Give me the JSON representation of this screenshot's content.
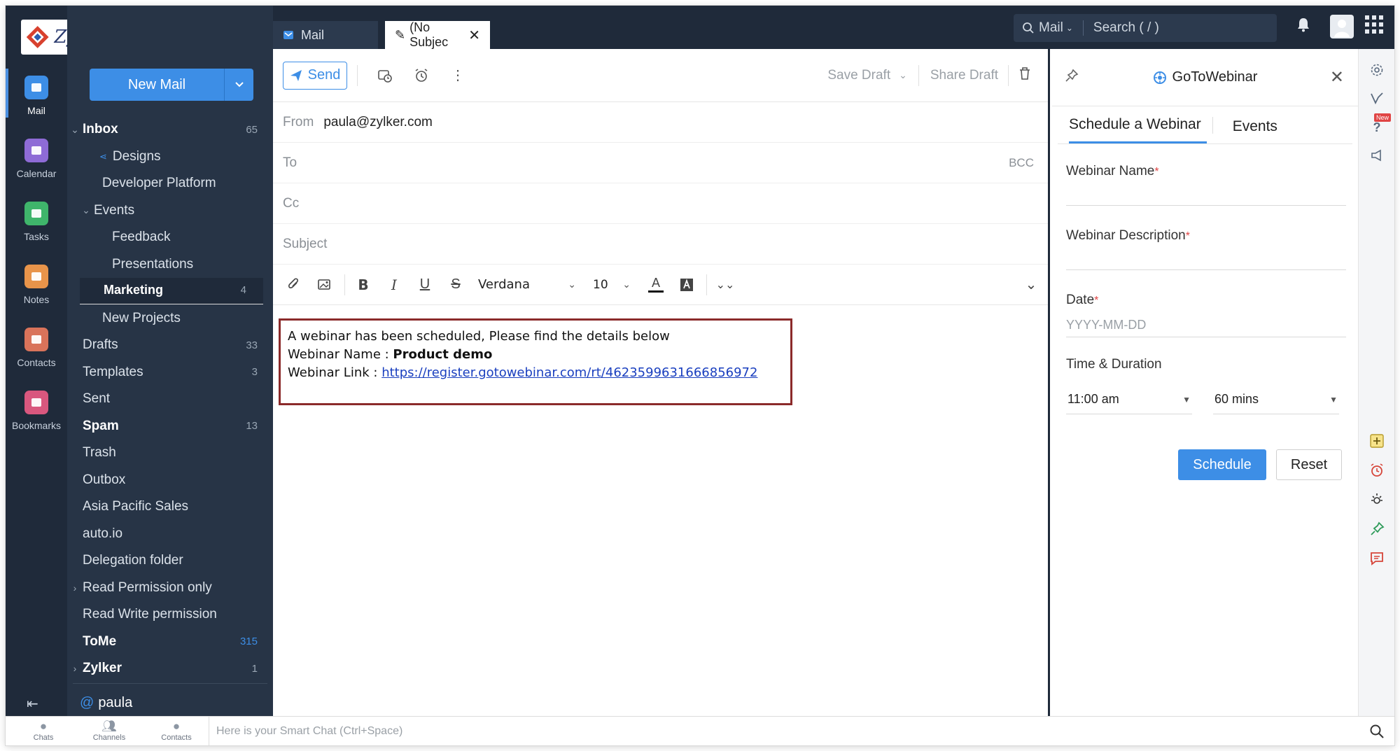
{
  "app": {
    "brand": "Zylker",
    "colors": {
      "accent": "#3d8ee6",
      "sidebar": "#273446",
      "rail": "#1f2a3a",
      "highlight_border": "#8b2a2a",
      "required": "#e04444"
    }
  },
  "rail": [
    {
      "label": "Mail",
      "icon": "mail-icon",
      "color": "#3d8ee6"
    },
    {
      "label": "Calendar",
      "icon": "calendar-icon",
      "color": "#8e6bd6"
    },
    {
      "label": "Tasks",
      "icon": "tasks-icon",
      "color": "#3fb56b"
    },
    {
      "label": "Notes",
      "icon": "notes-icon",
      "color": "#e8944a"
    },
    {
      "label": "Contacts",
      "icon": "contacts-icon",
      "color": "#d9735a"
    },
    {
      "label": "Bookmarks",
      "icon": "bookmarks-icon",
      "color": "#d9577e"
    }
  ],
  "folders": {
    "new_mail": "New Mail",
    "items": [
      {
        "name": "Inbox",
        "count": "65",
        "bold": true,
        "chev": "⌄",
        "indent": 0
      },
      {
        "name": "Designs",
        "count": "",
        "bold": false,
        "indent": 2,
        "shared": true
      },
      {
        "name": "Developer Platform",
        "count": "",
        "bold": false,
        "indent": 2
      },
      {
        "name": "Events",
        "count": "",
        "bold": false,
        "chev": "⌄",
        "indent": 1
      },
      {
        "name": "Feedback",
        "count": "",
        "bold": false,
        "indent": 3
      },
      {
        "name": "Presentations",
        "count": "",
        "bold": false,
        "indent": 3
      },
      {
        "name": "Marketing",
        "count": "4",
        "bold": true,
        "indent": 2,
        "selected": true
      },
      {
        "name": "New Projects",
        "count": "",
        "bold": false,
        "indent": 2
      },
      {
        "name": "Drafts",
        "count": "33",
        "bold": false,
        "indent": 0
      },
      {
        "name": "Templates",
        "count": "3",
        "bold": false,
        "indent": 0
      },
      {
        "name": "Sent",
        "count": "",
        "bold": false,
        "indent": 0
      },
      {
        "name": "Spam",
        "count": "13",
        "bold": true,
        "indent": 0
      },
      {
        "name": "Trash",
        "count": "",
        "bold": false,
        "indent": 0
      },
      {
        "name": "Outbox",
        "count": "",
        "bold": false,
        "indent": 0
      },
      {
        "name": "Asia Pacific Sales",
        "count": "",
        "bold": false,
        "indent": 0
      },
      {
        "name": "auto.io",
        "count": "",
        "bold": false,
        "indent": 0
      },
      {
        "name": "Delegation folder",
        "count": "",
        "bold": false,
        "indent": 0
      },
      {
        "name": "Read Permission only",
        "count": "",
        "bold": false,
        "chev": "›",
        "indent": 0
      },
      {
        "name": "Read Write permission",
        "count": "",
        "bold": false,
        "indent": 0
      },
      {
        "name": "ToMe",
        "count": "315",
        "bold": true,
        "indent": 0,
        "count_blue": true
      },
      {
        "name": "Zylker",
        "count": "1",
        "bold": true,
        "chev": "›",
        "indent": 0
      }
    ],
    "user": "paula"
  },
  "topbar": {
    "tab_mail": "Mail",
    "tab_compose": "(No Subjec",
    "search_scope": "Mail",
    "search_placeholder": "Search ( / )"
  },
  "compose": {
    "send_label": "Send",
    "save_draft": "Save Draft",
    "share_draft": "Share Draft",
    "from_label": "From",
    "from_value": "paula@zylker.com",
    "to_label": "To",
    "bcc_label": "BCC",
    "cc_label": "Cc",
    "subject_label": "Subject",
    "font": "Verdana",
    "font_size": "10",
    "body": {
      "line1": "A webinar has been scheduled, Please find the details below",
      "name_label": "Webinar Name : ",
      "name_value": "Product demo",
      "link_label": "Webinar Link : ",
      "link_value": "https://register.gotowebinar.com/rt/4623599631666856972"
    }
  },
  "panel": {
    "title": "GoToWebinar",
    "tabs": [
      "Schedule a Webinar",
      "Events"
    ],
    "webinar_name_label": "Webinar Name",
    "webinar_desc_label": "Webinar Description",
    "date_label": "Date",
    "date_placeholder": "YYYY-MM-DD",
    "time_label": "Time & Duration",
    "time_value": "11:00 am",
    "duration_value": "60 mins",
    "schedule_btn": "Schedule",
    "reset_btn": "Reset",
    "required_mark": "*"
  },
  "strip": {
    "new_badge": "New"
  },
  "bottombar": {
    "chats": "Chats",
    "channels": "Channels",
    "contacts": "Contacts",
    "smart_chat": "Here is your Smart Chat (Ctrl+Space)"
  }
}
